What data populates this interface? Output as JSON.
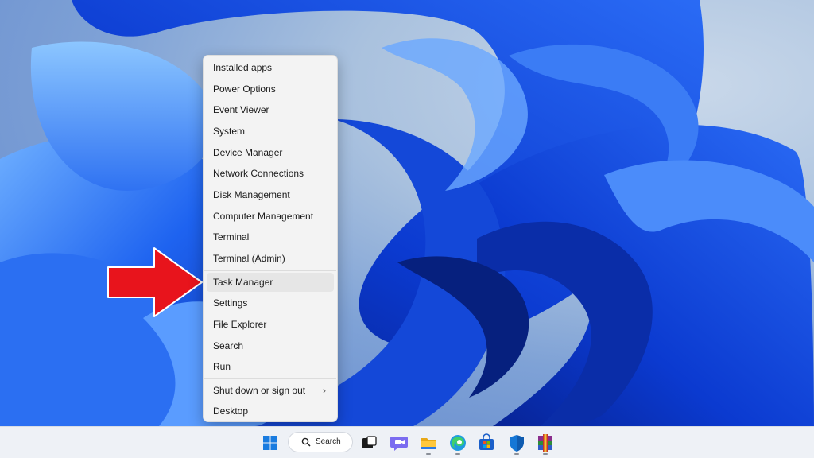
{
  "context_menu": {
    "items": [
      {
        "label": "Installed apps"
      },
      {
        "label": "Power Options"
      },
      {
        "label": "Event Viewer"
      },
      {
        "label": "System"
      },
      {
        "label": "Device Manager"
      },
      {
        "label": "Network Connections"
      },
      {
        "label": "Disk Management"
      },
      {
        "label": "Computer Management"
      },
      {
        "label": "Terminal"
      },
      {
        "label": "Terminal (Admin)"
      },
      {
        "label": "Task Manager"
      },
      {
        "label": "Settings"
      },
      {
        "label": "File Explorer"
      },
      {
        "label": "Search"
      },
      {
        "label": "Run"
      },
      {
        "label": "Shut down or sign out"
      },
      {
        "label": "Desktop"
      }
    ],
    "highlighted_item": "Task Manager",
    "submenu_indicator": "›"
  },
  "taskbar": {
    "search_label": "Search",
    "apps": [
      {
        "icon": "windows-start-icon"
      },
      {
        "icon": "search-icon"
      },
      {
        "icon": "task-view-icon"
      },
      {
        "icon": "teams-chat-icon"
      },
      {
        "icon": "file-explorer-icon"
      },
      {
        "icon": "edge-browser-icon"
      },
      {
        "icon": "microsoft-store-icon"
      },
      {
        "icon": "windows-security-icon"
      },
      {
        "icon": "winrar-icon"
      }
    ]
  },
  "colors": {
    "accent_arrow": "#e8141c",
    "wallpaper_blue": "#1f5fe0",
    "menu_background": "#f3f3f3",
    "taskbar_background": "#eef1f6"
  }
}
